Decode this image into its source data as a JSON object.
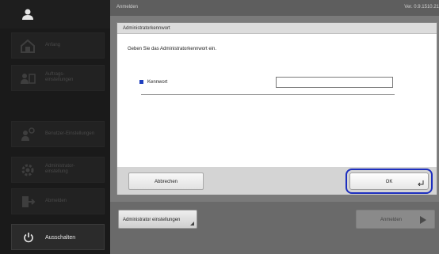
{
  "header": {
    "title": "Anmelden",
    "version": "Ver. 0.9.1510.21"
  },
  "sidebar": {
    "user_icon": "user-icon",
    "items": [
      {
        "label": "Anfang",
        "icon": "home-icon"
      },
      {
        "label": "Auftrags-",
        "label2": "einstellungen",
        "icon": "job-settings-icon"
      },
      {
        "label": "Benutzer-Einstellungen",
        "icon": "user-settings-icon"
      },
      {
        "label": "Administrator-",
        "label2": "einstellung",
        "icon": "admin-gear-icon"
      },
      {
        "label": "Abmelden",
        "icon": "logout-icon"
      }
    ],
    "power_label": "Ausschalten"
  },
  "dialog": {
    "title": "Administratorkennwort",
    "prompt": "Geben Sie das Administratorkennwort ein.",
    "field_label": "Kennwort",
    "field_value": "",
    "cancel_label": "Abbrechen",
    "ok_label": "OK"
  },
  "footer": {
    "admin_settings_label": "Administrator einstellungen",
    "login_label": "Anmelden"
  },
  "colors": {
    "accent": "#1d2fbf",
    "sidebar_bg": "#1a1a1a",
    "main_bg": "#7a7a7a"
  }
}
